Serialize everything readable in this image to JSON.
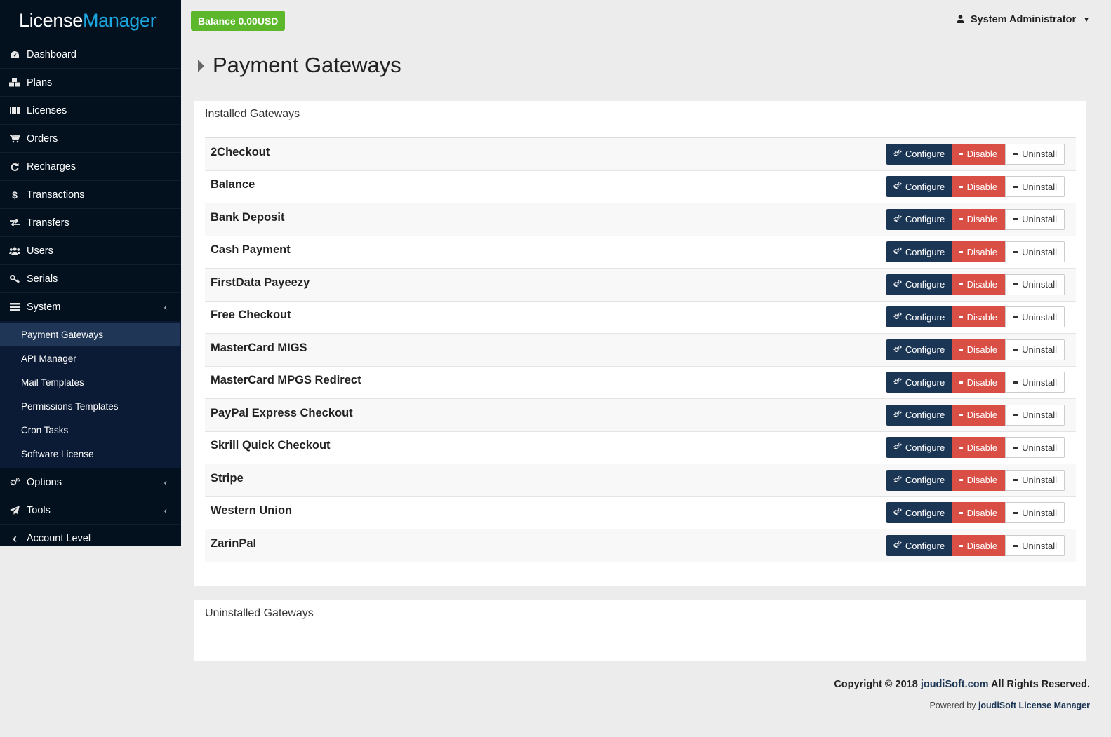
{
  "app": {
    "logo_part1": "License",
    "logo_part2": "Manager"
  },
  "topbar": {
    "balance": "Balance 0.00USD",
    "user_name": "System Administrator"
  },
  "sidebar": {
    "items": [
      {
        "label": "Dashboard",
        "icon": "dashboard-icon"
      },
      {
        "label": "Plans",
        "icon": "cubes-icon"
      },
      {
        "label": "Licenses",
        "icon": "barcode-icon"
      },
      {
        "label": "Orders",
        "icon": "cart-icon"
      },
      {
        "label": "Recharges",
        "icon": "refresh-icon"
      },
      {
        "label": "Transactions",
        "icon": "dollar-icon"
      },
      {
        "label": "Transfers",
        "icon": "exchange-icon"
      },
      {
        "label": "Users",
        "icon": "users-icon"
      },
      {
        "label": "Serials",
        "icon": "key-icon"
      },
      {
        "label": "System",
        "icon": "tasks-icon"
      }
    ],
    "system_submenu": [
      {
        "label": "Payment Gateways",
        "active": true
      },
      {
        "label": "API Manager"
      },
      {
        "label": "Mail Templates"
      },
      {
        "label": "Permissions Templates"
      },
      {
        "label": "Cron Tasks"
      },
      {
        "label": "Software License"
      }
    ],
    "bottom_items": [
      {
        "label": "Options",
        "icon": "cogs-icon"
      },
      {
        "label": "Tools",
        "icon": "paper-plane-icon"
      },
      {
        "label": "Account Level",
        "icon": "chevron-left-icon"
      }
    ]
  },
  "page": {
    "title": "Payment Gateways"
  },
  "installed": {
    "heading": "Installed Gateways",
    "configure_label": "Configure",
    "disable_label": "Disable",
    "uninstall_label": "Uninstall",
    "gateways": [
      "2Checkout",
      "Balance",
      "Bank Deposit",
      "Cash Payment",
      "FirstData Payeezy",
      "Free Checkout",
      "MasterCard MIGS",
      "MasterCard MPGS Redirect",
      "PayPal Express Checkout",
      "Skrill Quick Checkout",
      "Stripe",
      "Western Union",
      "ZarinPal"
    ]
  },
  "uninstalled": {
    "heading": "Uninstalled Gateways"
  },
  "footer": {
    "copyright_prefix": "Copyright © 2018 ",
    "copyright_link": "joudiSoft.com",
    "copyright_suffix": " All Rights Reserved.",
    "powered_prefix": "Powered by ",
    "powered_link": "joudiSoft License Manager"
  },
  "colors": {
    "sidebar_bg": "#03111f",
    "submenu_bg": "#0b1b36",
    "active_bg": "#1f3656",
    "logo_accent": "#1ba6e0",
    "balance_green": "#5cb82a",
    "configure_navy": "#1b3554",
    "disable_red": "#d94e45"
  }
}
